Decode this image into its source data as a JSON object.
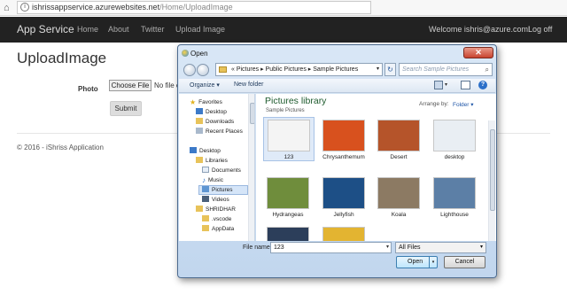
{
  "browser": {
    "url_host": "ishrissappservice.azurewebsites.net",
    "url_path": "/Home/UploadImage"
  },
  "navbar": {
    "brand": "App Service",
    "links": [
      "Home",
      "About",
      "Twitter",
      "Upload Image"
    ],
    "welcome": "Welcome ishris@azure.com!",
    "logoff": "Log off"
  },
  "page": {
    "title": "UploadImage",
    "photo_label": "Photo",
    "choose_button": "Choose File",
    "no_file": "No file c",
    "submit": "Submit",
    "footer": "© 2016 - iShriss Application"
  },
  "dialog": {
    "title": "Open",
    "close_glyph": "✕",
    "breadcrumb": "« Pictures ▸ Public Pictures ▸ Sample Pictures",
    "search_placeholder": "Search Sample Pictures",
    "toolbar": {
      "organize": "Organize ▾",
      "new_folder": "New folder"
    },
    "nav": {
      "favorites": "Favorites",
      "desktop": "Desktop",
      "downloads": "Downloads",
      "recent": "Recent Places",
      "desktop2": "Desktop",
      "libraries": "Libraries",
      "documents": "Documents",
      "music": "Music",
      "pictures": "Pictures",
      "videos": "Videos",
      "user": "SHRIDHAR",
      "vscode": ".vscode",
      "appdata": "AppData"
    },
    "library": {
      "title": "Pictures library",
      "subtitle": "Sample Pictures",
      "arrange_label": "Arrange by:",
      "arrange_value": "Folder ▾"
    },
    "files": [
      {
        "name": "123",
        "color": "#f4f4f4"
      },
      {
        "name": "Chrysanthemum",
        "color": "#d8511e"
      },
      {
        "name": "Desert",
        "color": "#b5542a"
      },
      {
        "name": "desktop",
        "color": "#e9eef3"
      },
      {
        "name": "Hydrangeas",
        "color": "#6f8d3c"
      },
      {
        "name": "Jellyfish",
        "color": "#1d4f86"
      },
      {
        "name": "Koala",
        "color": "#8c7a63"
      },
      {
        "name": "Lighthouse",
        "color": "#5c7fa6"
      }
    ],
    "filename_label": "File name:",
    "filename_value": "123",
    "filetype_value": "All Files",
    "open_button": "Open",
    "cancel_button": "Cancel"
  }
}
